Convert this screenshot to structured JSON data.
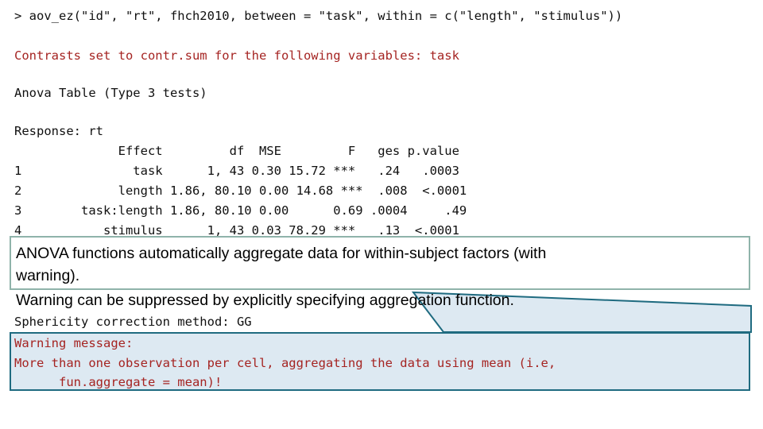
{
  "console": {
    "command": "> aov_ez(\"id\", \"rt\", fhch2010, between = \"task\", within = c(\"length\", \"stimulus\"))",
    "contrasts_note": "Contrasts set to contr.sum for the following variables: task",
    "anova_title": "Anova Table (Type 3 tests)",
    "response_label": "Response: rt",
    "sphericity": "Sphericity correction method: GG"
  },
  "anova_table": {
    "header": "              Effect         df  MSE         F   ges p.value",
    "rows": [
      "1               task      1, 43 0.30 15.72 ***   .24   .0003",
      "2             length 1.86, 80.10 0.00 14.68 ***  .008  <.0001",
      "3        task:length 1.86, 80.10 0.00      0.69 .0004     .49",
      "4           stimulus      1, 43 0.03 78.29 ***   .13  <.0001"
    ],
    "columns": [
      "",
      "Effect",
      "df",
      "MSE",
      "F",
      "ges",
      "p.value"
    ],
    "data": [
      {
        "index": "1",
        "effect": "task",
        "df": "1, 43",
        "mse": "0.30",
        "f": "15.72",
        "sig": "***",
        "ges": ".24",
        "p_value": ".0003"
      },
      {
        "index": "2",
        "effect": "length",
        "df": "1.86, 80.10",
        "mse": "0.00",
        "f": "14.68",
        "sig": "***",
        "ges": ".008",
        "p_value": "<.0001"
      },
      {
        "index": "3",
        "effect": "task:length",
        "df": "1.86, 80.10",
        "mse": "0.00",
        "f": "0.69",
        "sig": "",
        "ges": ".0004",
        "p_value": ".49"
      },
      {
        "index": "4",
        "effect": "stimulus",
        "df": "1, 43",
        "mse": "0.03",
        "f": "78.29",
        "sig": "***",
        "ges": ".13",
        "p_value": "<.0001"
      }
    ]
  },
  "annotation": {
    "line_1": "ANOVA functions automatically aggregate data for within-subject factors (with",
    "line_2": "warning).",
    "line_3": "Warning can be suppressed by explicitly specifying aggregation function."
  },
  "warning": {
    "line_1": "Warning message:",
    "line_2": "More than one observation per cell, aggregating the data using mean (i.e,",
    "line_3": "      fun.aggregate = mean)!"
  },
  "colors": {
    "console_text": "#101010",
    "red_text": "#A52422",
    "annotation_border": "#8FB3AA",
    "warning_border": "#1F6B80",
    "warning_fill": "#DDE9F2",
    "background": "#FFFFFF"
  }
}
